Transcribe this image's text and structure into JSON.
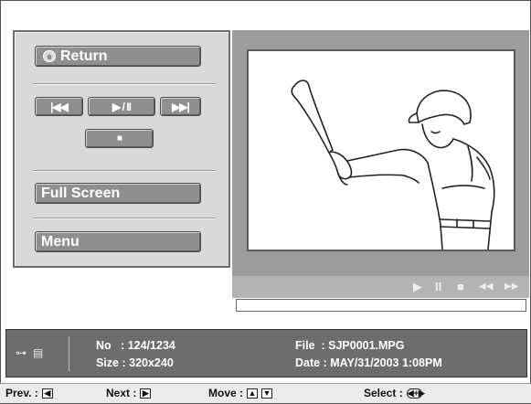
{
  "controls": {
    "return_label": "Return",
    "prev_glyph": "|◀◀",
    "play_pause_glyph": "▶ / II",
    "next_glyph": "▶▶|",
    "stop_glyph": "■",
    "fullscreen_label": "Full Screen",
    "menu_label": "Menu"
  },
  "transport": {
    "play": "▶",
    "pause": "II",
    "stop": "■",
    "rewind": "◀◀",
    "forward": "▶▶",
    "progress": 0.0
  },
  "info": {
    "key_icon": "key-icon",
    "film_icon": "film-icon",
    "no_line": "No   : 124/1234",
    "size_line": "Size : 320x240",
    "file_line": "File  : SJP0001.MPG",
    "date_line": "Date : MAY/31/2003 1:08PM"
  },
  "help": {
    "prev_label": "Prev. :",
    "next_label": "Next :",
    "move_label": "Move :",
    "select_label": "Select :",
    "left_key": "◀",
    "right_key": "▶",
    "up_key": "▲",
    "down_key": "▼",
    "select_key": "◀+▶"
  },
  "colors": {
    "panel": "#d9d9d9",
    "button": "#8f8f8f",
    "video_bg": "#9c9c9c",
    "info_bar": "#6d6d6d"
  }
}
